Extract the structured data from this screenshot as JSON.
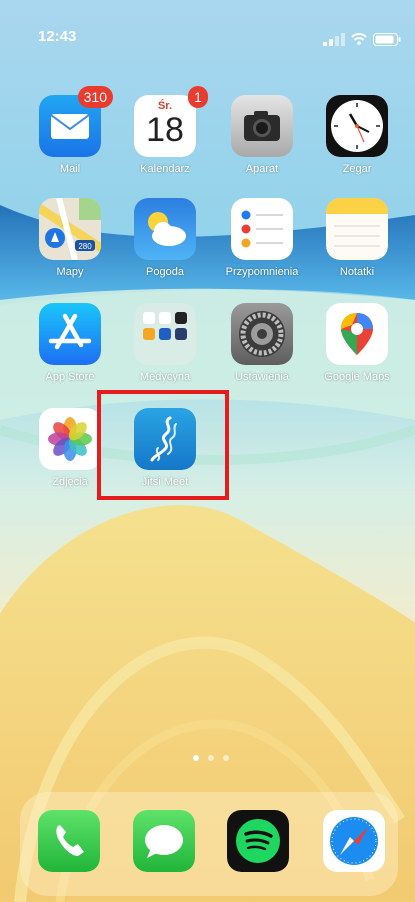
{
  "status_bar": {
    "time": "12:43"
  },
  "apps": [
    {
      "id": "mail",
      "label": "Mail",
      "badge": "310",
      "icon": "mail-icon"
    },
    {
      "id": "calendar",
      "label": "Kalendarz",
      "badge": "1",
      "icon": "calendar-icon",
      "weekday": "Śr.",
      "day": "18"
    },
    {
      "id": "camera",
      "label": "Aparat",
      "icon": "camera-icon"
    },
    {
      "id": "clock",
      "label": "Zegar",
      "icon": "clock-icon"
    },
    {
      "id": "maps",
      "label": "Mapy",
      "icon": "maps-icon",
      "route_number": "280"
    },
    {
      "id": "weather",
      "label": "Pogoda",
      "icon": "weather-icon"
    },
    {
      "id": "reminders",
      "label": "Przypomnienia",
      "icon": "reminders-icon"
    },
    {
      "id": "notes",
      "label": "Notatki",
      "icon": "notes-icon"
    },
    {
      "id": "appstore",
      "label": "App Store",
      "icon": "app-store-icon"
    },
    {
      "id": "medycyna",
      "label": "Medycyna",
      "icon": "folder-icon"
    },
    {
      "id": "settings",
      "label": "Ustawienia",
      "icon": "gear-icon"
    },
    {
      "id": "googlemaps",
      "label": "Google Maps",
      "icon": "google-maps-icon"
    },
    {
      "id": "photos",
      "label": "Zdjęcia",
      "icon": "photos-icon"
    },
    {
      "id": "jitsi",
      "label": "Jitsi Meet",
      "icon": "jitsi-meet-icon"
    }
  ],
  "dock": [
    {
      "id": "phone",
      "icon": "phone-icon"
    },
    {
      "id": "messages",
      "icon": "messages-icon"
    },
    {
      "id": "spotify",
      "icon": "spotify-icon"
    },
    {
      "id": "safari",
      "icon": "safari-icon"
    }
  ],
  "page_indicator": {
    "count": 3,
    "active": 1
  },
  "highlight": {
    "target": "jitsi",
    "color": "#e61b1b"
  },
  "colors": {
    "accent_highlight": "#e61b1b",
    "badge": "#ea3b2f"
  }
}
